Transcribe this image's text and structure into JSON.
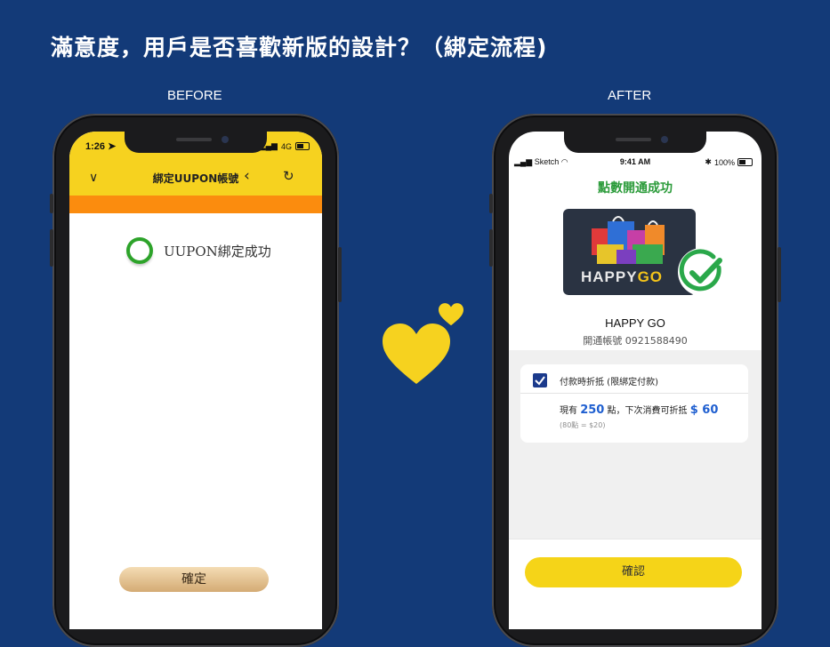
{
  "heading": "滿意度，用戶是否喜歡新版的設計？（綁定流程)",
  "labels": {
    "before": "BEFORE",
    "after": "AFTER"
  },
  "before_screen": {
    "status_time": "1:26",
    "status_network": "4G",
    "nav_title": "綁定UUPON帳號",
    "success_text": "UUPON綁定成功",
    "confirm_label": "確定",
    "colors": {
      "header": "#f6d21f",
      "band": "#fb8c0e",
      "success_ring": "#2da32a"
    }
  },
  "after_screen": {
    "status_carrier": "Sketch",
    "status_time": "9:41 AM",
    "status_battery": "100%",
    "title": "點數開通成功",
    "card_text_1": "HAPPY",
    "card_text_2": "GO",
    "brand_name": "HAPPY GO",
    "account": "開通帳號 0921588490",
    "option_label": "付款時折抵 (限綁定付款)",
    "points_prefix": "現有",
    "points_value": "250",
    "points_mid": "點，下次消費可折抵",
    "discount_value": "$ 60",
    "rule": "(80點 = $20)",
    "confirm_label": "確認",
    "colors": {
      "title": "#2b9b3a",
      "accent": "#1f5fd0",
      "button": "#f5d418",
      "checkbox": "#1b3a8c"
    }
  },
  "icons": [
    "chevron-down-icon",
    "back-arrow-icon",
    "refresh-icon",
    "heart-icon",
    "check-circle-icon"
  ]
}
